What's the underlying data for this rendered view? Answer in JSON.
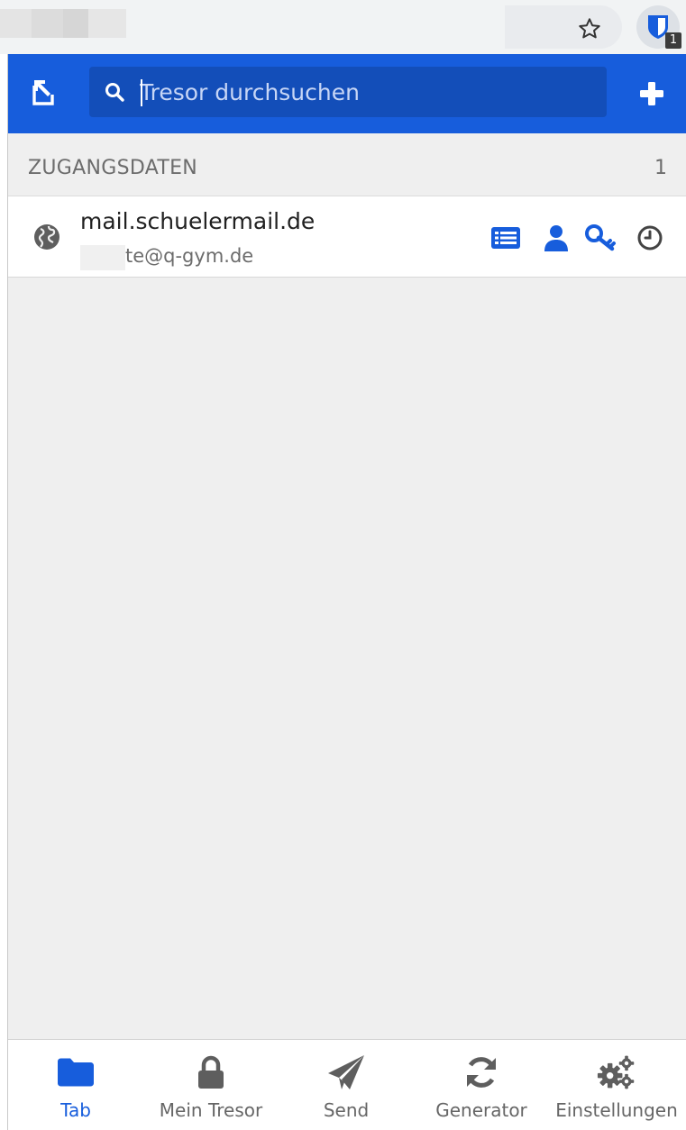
{
  "browser": {
    "extension_badge": "1"
  },
  "header": {
    "search_placeholder": "Tresor durchsuchen"
  },
  "section": {
    "title": "ZUGANGSDATEN",
    "count": "1"
  },
  "items": [
    {
      "name": "mail.schuelermail.de",
      "username": "te@q-gym.de",
      "icon": "globe-icon"
    }
  ],
  "tabs": [
    {
      "label": "Tab",
      "icon": "folder-icon",
      "active": true
    },
    {
      "label": "Mein Tresor",
      "icon": "lock-icon",
      "active": false
    },
    {
      "label": "Send",
      "icon": "paper-plane-icon",
      "active": false
    },
    {
      "label": "Generator",
      "icon": "refresh-icon",
      "active": false
    },
    {
      "label": "Einstellungen",
      "icon": "gears-icon",
      "active": false
    }
  ],
  "colors": {
    "brand": "#175ddc",
    "search_bg": "#134eb9",
    "background": "#efefef",
    "muted_text": "#6c6c6c",
    "icon_gray": "#5e5e5e"
  }
}
